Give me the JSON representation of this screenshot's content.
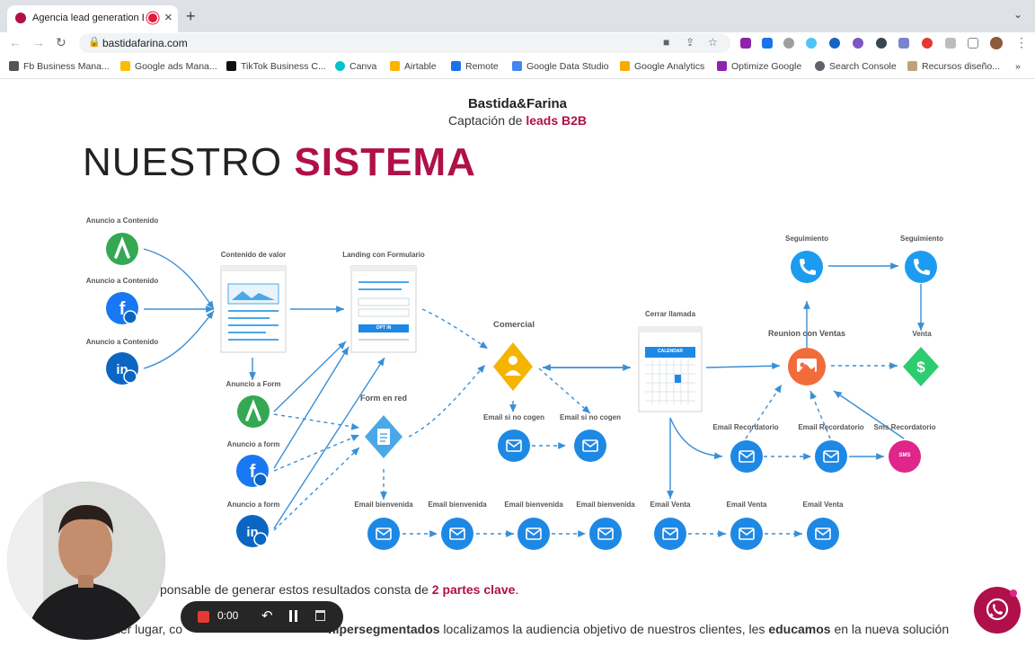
{
  "browser": {
    "tab_title": "Agencia lead generation B",
    "new_tab_symbol": "+",
    "url": "bastidafarina.com",
    "bookmarks": [
      "Fb Business Mana...",
      "Google ads Mana...",
      "TikTok Business C...",
      "Canva",
      "Airtable",
      "Remote",
      "Google Data Studio",
      "Google Analytics",
      "Optimize Google",
      "Search Console",
      "Recursos diseño..."
    ],
    "bookmarks_overflow": "»"
  },
  "page": {
    "brand_name": "Bastida&Farina",
    "brand_subtitle_prefix": "Captación de ",
    "brand_subtitle_highlight": "leads B2B",
    "headline_plain": "NUESTRO ",
    "headline_highlight": "SISTEMA",
    "accent_color": "#b01049",
    "paragraph1_plain": "ponsable de generar estos resultados consta de ",
    "paragraph1_highlight": "2 partes clave",
    "paragraph1_end": ".",
    "paragraph2_a": "ner lugar, co",
    "paragraph2_b": "hipersegmentados",
    "paragraph2_c": " localizamos la audiencia objetivo de nuestros clientes, les ",
    "paragraph2_d": "educamos",
    "paragraph2_e": " en la nueva solución"
  },
  "diagram": {
    "labels": {
      "anuncio_contenido": "Anuncio a Contenido",
      "contenido_valor": "Contenido de valor",
      "landing": "Landing con Formulario",
      "opt_in": "OPT IN",
      "anuncio_form": "Anuncio a Form",
      "anuncio_form_lower": "Anuncio a form",
      "form_en_red": "Form en red",
      "comercial": "Comercial",
      "email_si_no_cogen": "Email si no cogen",
      "cerrar_llamada": "Cerrar llamada",
      "calendar": "CALENDAR",
      "seguimiento": "Seguimiento",
      "reunion": "Reunion con Ventas",
      "venta": "Venta",
      "email_recordatorio": "Email Recordatorio",
      "sms_recordatorio": "Sms Recordatorio",
      "sms": "SMS",
      "email_bienvenida": "Email bienvenida",
      "email_venta": "Email Venta"
    },
    "colors": {
      "google_ads": "#34a853",
      "facebook": "#1877f2",
      "linkedin": "#0a66c2",
      "email": "#1e88e5",
      "phone": "#1d9bf0",
      "comercial": "#f5b400",
      "reunion": "#f26b3a",
      "venta": "#2ecc71",
      "sms": "#e0268a",
      "form": "#4aa8e8",
      "arrow": "#3a8fd6"
    }
  },
  "recorder": {
    "time": "0:00"
  },
  "icons": [
    "google-ads-icon",
    "facebook-icon",
    "linkedin-icon",
    "email-icon",
    "phone-icon",
    "user-icon",
    "money-icon",
    "presentation-icon",
    "sms-icon",
    "form-icon",
    "calendar-icon",
    "whatsapp-icon"
  ]
}
